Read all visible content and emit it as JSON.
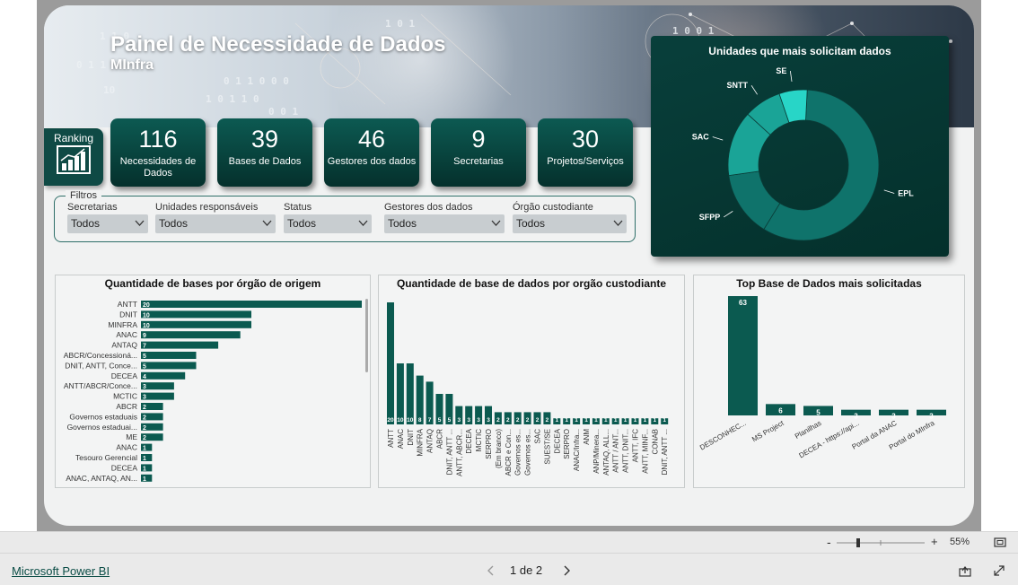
{
  "header": {
    "title": "Painel de Necessidade de Dados",
    "subtitle": "MInfra"
  },
  "ranking": {
    "label": "Ranking"
  },
  "kpis": [
    {
      "value": "116",
      "label": "Necessidades de Dados"
    },
    {
      "value": "39",
      "label": "Bases de Dados"
    },
    {
      "value": "46",
      "label": "Gestores dos dados"
    },
    {
      "value": "9",
      "label": "Secretarias"
    },
    {
      "value": "30",
      "label": "Projetos/Serviços"
    }
  ],
  "filters": {
    "legend": "Filtros",
    "items": [
      {
        "label": "Secretarias",
        "value": "Todos"
      },
      {
        "label": "Unidades responsáveis",
        "value": "Todos"
      },
      {
        "label": "Status",
        "value": "Todos"
      },
      {
        "label": "Gestores dos dados",
        "value": "Todos"
      },
      {
        "label": "Órgão custodiante",
        "value": "Todos"
      }
    ]
  },
  "colors": {
    "dark_teal": "#0f4a45",
    "bar": "#0b5a50",
    "donut_main": "#0f736b",
    "donut_light": "#1aa497",
    "donut_cyan": "#28d5c7"
  },
  "chart_data": [
    {
      "type": "pie",
      "title": "Unidades que mais solicitam dados",
      "labels": [
        "EPL",
        "SFPP",
        "SAC",
        "SNTT",
        "SE"
      ],
      "values": [
        58,
        14,
        14,
        8,
        6
      ]
    },
    {
      "type": "bar",
      "title": "Quantidade de bases por órgão de origem",
      "categories": [
        "ANTT",
        "DNIT",
        "MINFRA",
        "ANAC",
        "ANTAQ",
        "ABCR/Concessioná...",
        "DNIT, ANTT, Conce...",
        "DECEA",
        "ANTT/ABCR/Conce...",
        "MCTIC",
        "ABCR",
        "Governos estaduais",
        "Governos estaduai...",
        "ME",
        "ANAC",
        "Tesouro Gerencial",
        "DECEA",
        "ANAC, ANTAQ, AN..."
      ],
      "values": [
        20,
        10,
        10,
        9,
        7,
        5,
        5,
        4,
        3,
        3,
        2,
        2,
        2,
        2,
        1,
        1,
        1,
        1
      ],
      "value_labels": [
        "20",
        "10",
        "10",
        "9",
        "7",
        "5",
        "5",
        "4",
        "3",
        "3",
        "2",
        "2",
        "2",
        "2",
        "1",
        "1",
        "1",
        "1"
      ]
    },
    {
      "type": "bar",
      "title": "Quantidade de base de dados por orgão custodiante",
      "categories": [
        "ANTT",
        "ANAC",
        "DNIT",
        "MINFRA",
        "ANTAQ",
        "ABCR",
        "DNIT, ANTT ...",
        "ANTT, ABCR...",
        "DECEA",
        "MCTIC",
        "SERPRO",
        "(Em branco)",
        "ABCR e Con...",
        "Governos es...",
        "Governos es...",
        "SAC",
        "SUEST/SE",
        "DECEA",
        "SERPRO",
        "ANAC/Infra...",
        "ANM",
        "ANP/Minera...",
        "ANTAQ, ALL...",
        "ANTT / ANT...",
        "ANTT, DNIT...",
        "ANTT, IFC",
        "ANTT, MINF...",
        "CONAB",
        "DNIT, ANTT ..."
      ],
      "values": [
        20,
        10,
        10,
        8,
        7,
        5,
        5,
        3,
        3,
        3,
        3,
        2,
        2,
        2,
        2,
        2,
        2,
        1,
        1,
        1,
        1,
        1,
        1,
        1,
        1,
        1,
        1,
        1,
        1
      ],
      "value_labels": [
        "20",
        "10",
        "10",
        "8",
        "7",
        "5",
        "5",
        "3",
        "3",
        "3",
        "3",
        "2",
        "2",
        "2",
        "2",
        "2",
        "2",
        "1",
        "1",
        "1",
        "1",
        "1",
        "1",
        "1",
        "1",
        "1",
        "1",
        "1",
        "1"
      ]
    },
    {
      "type": "bar",
      "title": "Top Base de Dados mais solicitadas",
      "categories": [
        "DESCONHEC...",
        "MS Project",
        "Planilhas",
        "DECEA - https://api...",
        "Portal da ANAC",
        "Portal do MInfra"
      ],
      "values": [
        63,
        6,
        5,
        3,
        3,
        3
      ],
      "value_labels": [
        "63",
        "6",
        "5",
        "3",
        "3",
        "3"
      ]
    }
  ],
  "footer": {
    "zoom": "55%",
    "minus": "-",
    "plus": "+",
    "brand": "Microsoft Power BI",
    "page": "1 de 2"
  }
}
